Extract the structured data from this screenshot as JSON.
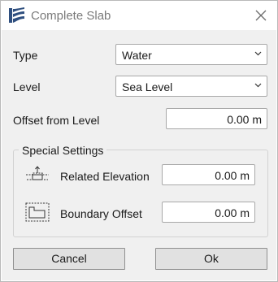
{
  "window": {
    "title": "Complete Slab"
  },
  "icons": {
    "app": "app-logo-icon",
    "close": "close-icon",
    "related_elevation": "related-elevation-icon",
    "boundary_offset": "boundary-offset-icon"
  },
  "form": {
    "type_label": "Type",
    "type_value": "Water",
    "level_label": "Level",
    "level_value": "Sea Level",
    "offset_label": "Offset from Level",
    "offset_value": "0.00 m"
  },
  "special_settings": {
    "title": "Special Settings",
    "related_elevation_label": "Related Elevation",
    "related_elevation_value": "0.00 m",
    "boundary_offset_label": "Boundary Offset",
    "boundary_offset_value": "0.00 m"
  },
  "buttons": {
    "cancel": "Cancel",
    "ok": "Ok"
  },
  "colors": {
    "logo": "#2f4f7f",
    "dialog_bg": "#f0f0f0",
    "button_bg": "#e1e1e1"
  }
}
